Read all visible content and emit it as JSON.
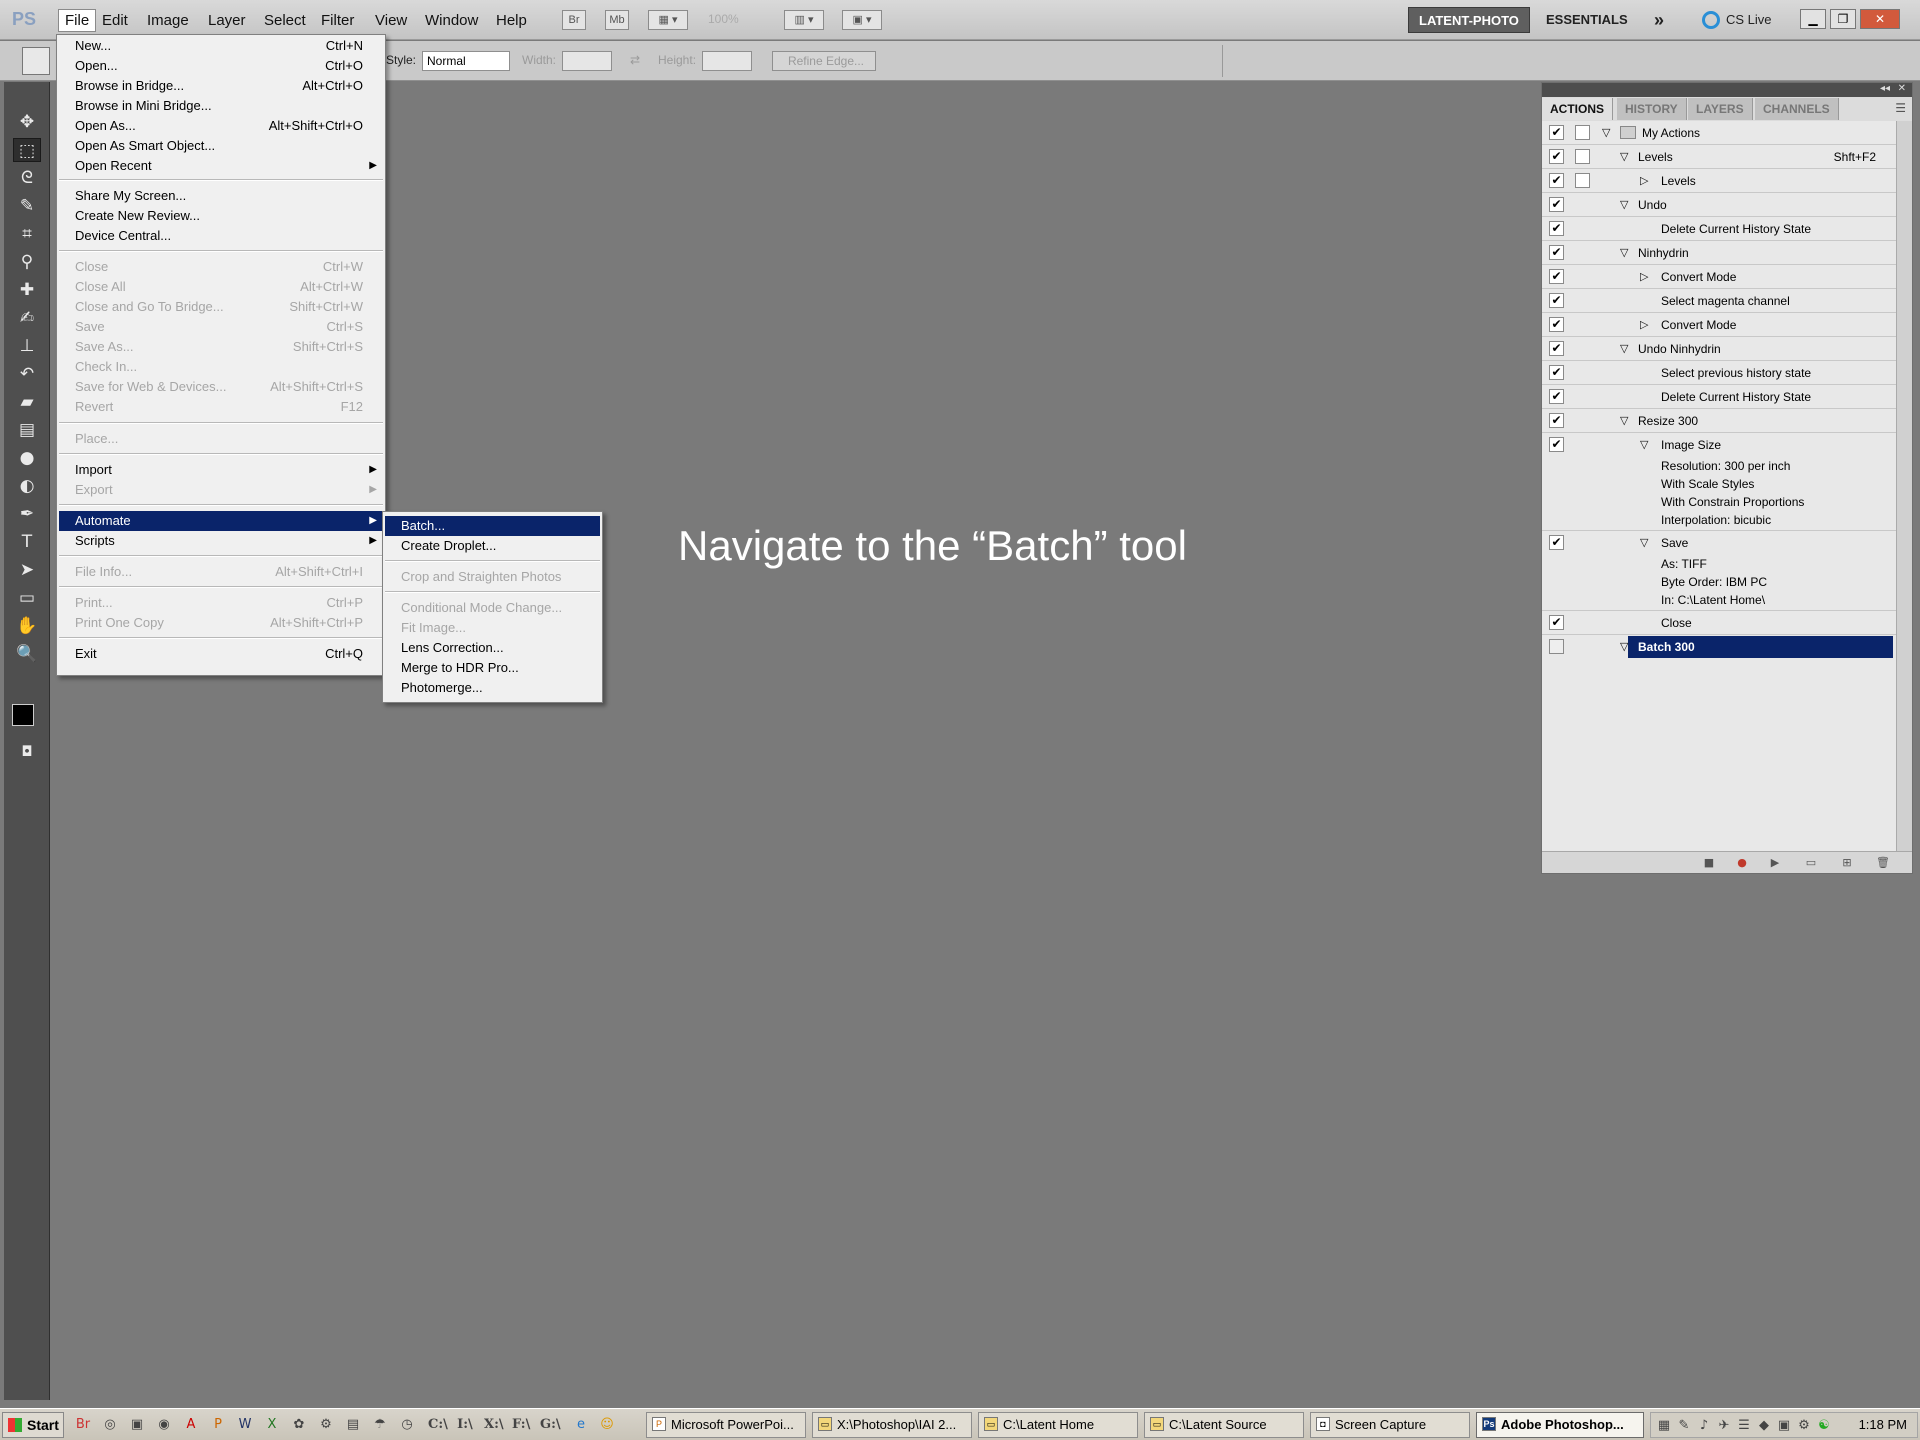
{
  "menubar": {
    "logo": "PS",
    "items": [
      "File",
      "Edit",
      "Image",
      "Layer",
      "Select",
      "Filter",
      "View",
      "Window",
      "Help"
    ],
    "bridge_btn": "Br",
    "minibridge_btn": "Mb",
    "zoom": "100%",
    "workspace_active": "LATENT-PHOTO",
    "workspace_other": "ESSENTIALS",
    "more": "»",
    "cslive": "CS Live"
  },
  "options": {
    "style_label": "Style:",
    "style_value": "Normal",
    "width_label": "Width:",
    "height_label": "Height:",
    "refine_label": "Refine Edge..."
  },
  "file_menu": [
    {
      "label": "New...",
      "shortcut": "Ctrl+N"
    },
    {
      "label": "Open...",
      "shortcut": "Ctrl+O"
    },
    {
      "label": "Browse in Bridge...",
      "shortcut": "Alt+Ctrl+O"
    },
    {
      "label": "Browse in Mini Bridge...",
      "shortcut": ""
    },
    {
      "label": "Open As...",
      "shortcut": "Alt+Shift+Ctrl+O"
    },
    {
      "label": "Open As Smart Object...",
      "shortcut": ""
    },
    {
      "label": "Open Recent",
      "shortcut": ""
    },
    {
      "label": "Share My Screen...",
      "shortcut": ""
    },
    {
      "label": "Create New Review...",
      "shortcut": ""
    },
    {
      "label": "Device Central...",
      "shortcut": ""
    },
    {
      "label": "Close",
      "shortcut": "Ctrl+W"
    },
    {
      "label": "Close All",
      "shortcut": "Alt+Ctrl+W"
    },
    {
      "label": "Close and Go To Bridge...",
      "shortcut": "Shift+Ctrl+W"
    },
    {
      "label": "Save",
      "shortcut": "Ctrl+S"
    },
    {
      "label": "Save As...",
      "shortcut": "Shift+Ctrl+S"
    },
    {
      "label": "Check In...",
      "shortcut": ""
    },
    {
      "label": "Save for Web & Devices...",
      "shortcut": "Alt+Shift+Ctrl+S"
    },
    {
      "label": "Revert",
      "shortcut": "F12"
    },
    {
      "label": "Place...",
      "shortcut": ""
    },
    {
      "label": "Import",
      "shortcut": ""
    },
    {
      "label": "Export",
      "shortcut": ""
    },
    {
      "label": "Automate",
      "shortcut": ""
    },
    {
      "label": "Scripts",
      "shortcut": ""
    },
    {
      "label": "File Info...",
      "shortcut": "Alt+Shift+Ctrl+I"
    },
    {
      "label": "Print...",
      "shortcut": "Ctrl+P"
    },
    {
      "label": "Print One Copy",
      "shortcut": "Alt+Shift+Ctrl+P"
    },
    {
      "label": "Exit",
      "shortcut": "Ctrl+Q"
    }
  ],
  "automate_menu": [
    "Batch...",
    "Create Droplet...",
    "Crop and Straighten Photos",
    "Conditional Mode Change...",
    "Fit Image...",
    "Lens Correction...",
    "Merge to HDR Pro...",
    "Photomerge..."
  ],
  "caption": "Navigate to the “Batch” tool",
  "panel": {
    "tabs": [
      "ACTIONS",
      "HISTORY",
      "LAYERS",
      "CHANNELS"
    ],
    "rows": [
      {
        "text": "My Actions",
        "shortcut": ""
      },
      {
        "text": "Levels",
        "shortcut": "Shft+F2"
      },
      {
        "text": "Levels",
        "shortcut": ""
      },
      {
        "text": "Undo",
        "shortcut": ""
      },
      {
        "text": "Delete Current History State",
        "shortcut": ""
      },
      {
        "text": "Ninhydrin",
        "shortcut": ""
      },
      {
        "text": "Convert Mode",
        "shortcut": ""
      },
      {
        "text": "Select magenta channel",
        "shortcut": ""
      },
      {
        "text": "Convert Mode",
        "shortcut": ""
      },
      {
        "text": "Undo Ninhydrin",
        "shortcut": ""
      },
      {
        "text": "Select previous history state",
        "shortcut": ""
      },
      {
        "text": "Delete Current History State",
        "shortcut": ""
      },
      {
        "text": "Resize 300",
        "shortcut": ""
      },
      {
        "text": "Image Size",
        "shortcut": ""
      },
      {
        "text": "Resolution: 300 per inch",
        "shortcut": ""
      },
      {
        "text": "With Scale Styles",
        "shortcut": ""
      },
      {
        "text": "With Constrain Proportions",
        "shortcut": ""
      },
      {
        "text": "Interpolation: bicubic",
        "shortcut": ""
      },
      {
        "text": "Save",
        "shortcut": ""
      },
      {
        "text": "As: TIFF",
        "shortcut": ""
      },
      {
        "text": "Byte Order: IBM PC",
        "shortcut": ""
      },
      {
        "text": "In: C:\\Latent Home\\",
        "shortcut": ""
      },
      {
        "text": "Close",
        "shortcut": ""
      },
      {
        "text": "Batch 300",
        "shortcut": ""
      }
    ]
  },
  "taskbar": {
    "start": "Start",
    "quick_drives": [
      "C:\\",
      "I:\\",
      "X:\\",
      "F:\\",
      "G:\\"
    ],
    "tasks": [
      "Microsoft PowerPoi...",
      "X:\\Photoshop\\IAI 2...",
      "C:\\Latent Home",
      "C:\\Latent Source",
      "Screen Capture",
      "Adobe Photoshop..."
    ],
    "clock": "1:18 PM"
  },
  "colors": {
    "highlight": "#0a246a",
    "workspace": "#7a7a7a",
    "toolbox": "#4f4f4f"
  }
}
